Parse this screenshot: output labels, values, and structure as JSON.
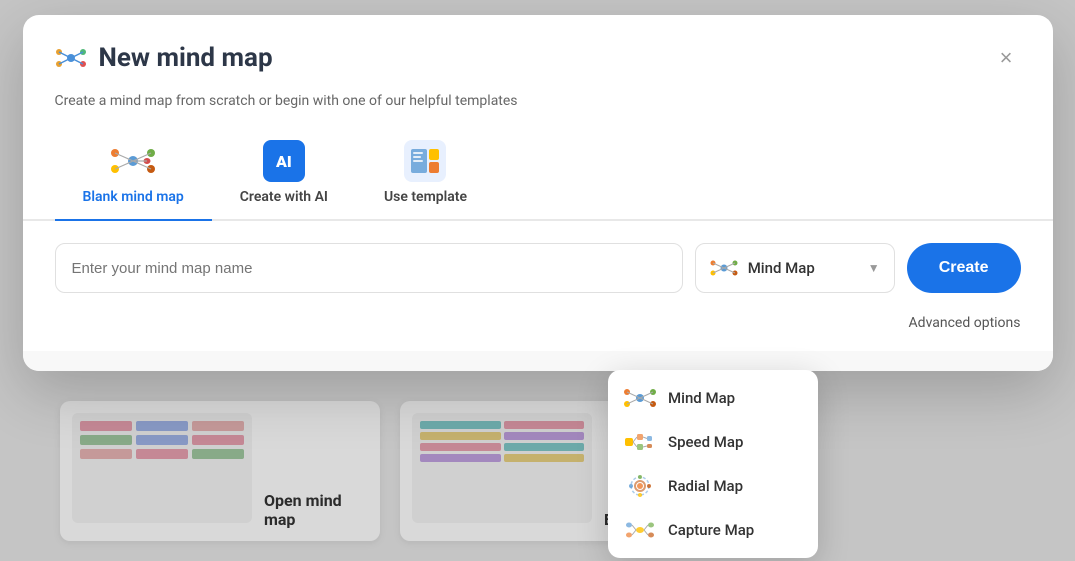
{
  "modal": {
    "title": "New mind map",
    "subtitle": "Create a mind map from scratch or begin with one of our helpful templates",
    "close_label": "×"
  },
  "tabs": [
    {
      "id": "blank",
      "label": "Blank mind map",
      "active": true
    },
    {
      "id": "ai",
      "label": "Create with AI",
      "active": false
    },
    {
      "id": "template",
      "label": "Use template",
      "active": false
    }
  ],
  "input": {
    "placeholder": "Enter your mind map name",
    "value": ""
  },
  "type_selector": {
    "current": "Mind Map"
  },
  "buttons": {
    "create": "Create",
    "advanced": "Advanced options"
  },
  "dropdown": {
    "items": [
      {
        "id": "mind-map",
        "label": "Mind Map"
      },
      {
        "id": "speed-map",
        "label": "Speed Map"
      },
      {
        "id": "radial-map",
        "label": "Radial Map"
      },
      {
        "id": "capture-map",
        "label": "Capture Map"
      }
    ]
  },
  "bg_cards": [
    {
      "title": "Open mind map",
      "id": "open"
    },
    {
      "title": "Event Plan",
      "id": "event"
    }
  ],
  "colors": {
    "accent": "#1a73e8",
    "title": "#2d3748",
    "text": "#666666"
  }
}
